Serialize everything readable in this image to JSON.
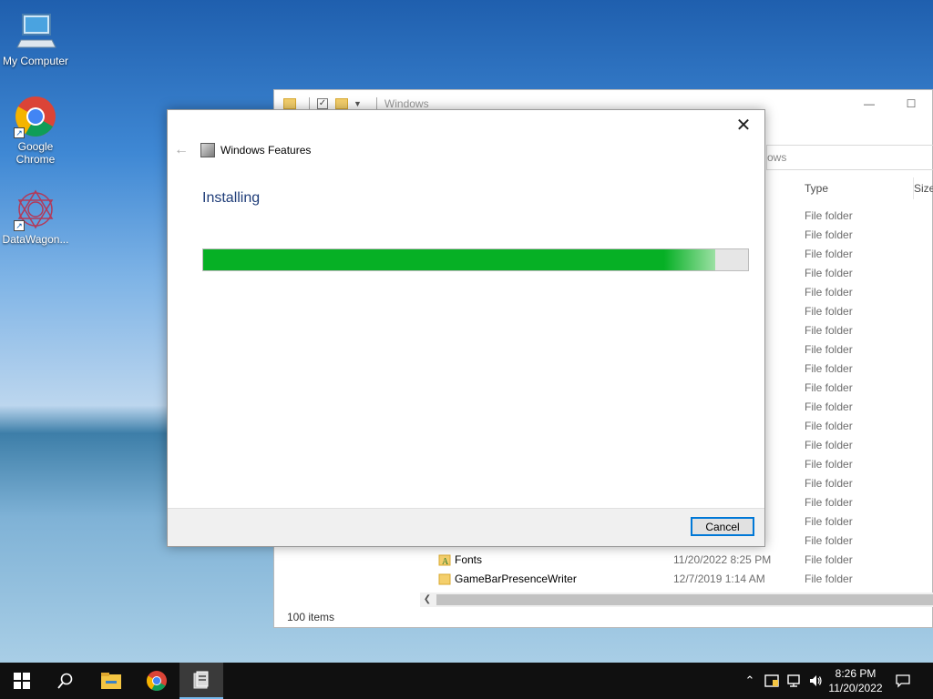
{
  "desktop": {
    "icons": [
      {
        "label": "My Computer"
      },
      {
        "label": "Google Chrome"
      },
      {
        "label": "DataWagon..."
      }
    ]
  },
  "explorer": {
    "title": "Windows",
    "address_partial": "ows",
    "col_type": "Type",
    "col_size": "Size",
    "type_values": [
      "File folder",
      "File folder",
      "File folder",
      "File folder",
      "File folder",
      "File folder",
      "File folder",
      "File folder",
      "File folder",
      "File folder",
      "File folder",
      "File folder",
      "File folder",
      "File folder",
      "File folder",
      "File folder",
      "File folder",
      "File folder",
      "File folder",
      "File folder"
    ],
    "rows": [
      {
        "name": "Fonts",
        "date": "11/20/2022 8:25 PM"
      },
      {
        "name": "GameBarPresenceWriter",
        "date": "12/7/2019 1:14 AM"
      }
    ],
    "status": "100 items"
  },
  "dialog": {
    "title": "Windows Features",
    "heading": "Installing",
    "progress": 0.94,
    "cancel_label": "Cancel",
    "close_glyph": "✕",
    "back_glyph": "←"
  },
  "taskbar": {
    "time": "8:26 PM",
    "date": "11/20/2022"
  },
  "colors": {
    "progress": "#06b025",
    "accent": "#0078d7",
    "heading": "#1e3c78"
  }
}
